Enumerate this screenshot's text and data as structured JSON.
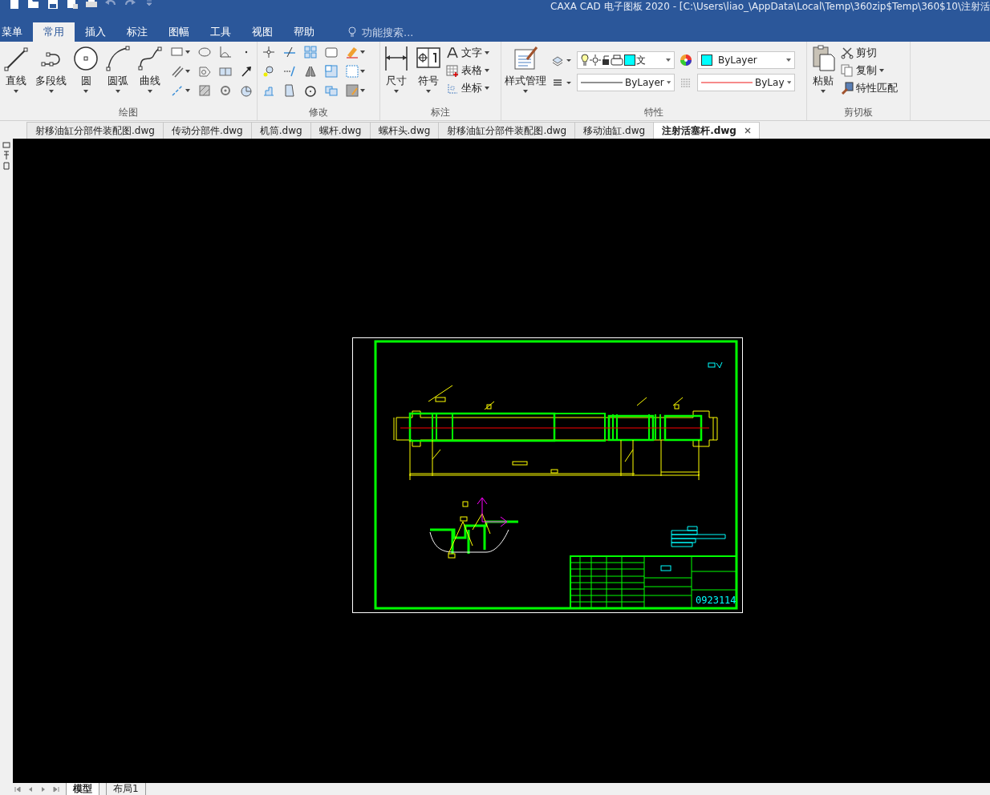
{
  "title_bar": {
    "title": "CAXA CAD 电子图板 2020 - [C:\\Users\\liao_\\AppData\\Local\\Temp\\360zip$Temp\\360$10\\注射活"
  },
  "menu_tabs": [
    {
      "label": "菜单",
      "selected": false
    },
    {
      "label": "常用",
      "selected": true
    },
    {
      "label": "插入",
      "selected": false
    },
    {
      "label": "标注",
      "selected": false
    },
    {
      "label": "图幅",
      "selected": false
    },
    {
      "label": "工具",
      "selected": false
    },
    {
      "label": "视图",
      "selected": false
    },
    {
      "label": "帮助",
      "selected": false
    }
  ],
  "search": {
    "placeholder": "功能搜索..."
  },
  "ribbon_groups": [
    {
      "kind": "draw",
      "title": "绘图",
      "large_buttons": [
        {
          "label": "直线"
        },
        {
          "label": "多段线"
        },
        {
          "label": "圆"
        },
        {
          "label": "圆弧"
        },
        {
          "label": "曲线"
        }
      ]
    },
    {
      "kind": "modify",
      "title": "修改"
    },
    {
      "kind": "annotate",
      "title": "标注",
      "large_buttons": [
        {
          "label": "尺寸"
        },
        {
          "label": "符号"
        }
      ],
      "small_buttons": [
        {
          "label": "文字"
        },
        {
          "label": "表格"
        },
        {
          "label": "坐标"
        }
      ]
    },
    {
      "kind": "properties",
      "title": "特性",
      "large_buttons": [
        {
          "label": "样式管理"
        }
      ],
      "layer": "文",
      "color_setting": "ByLayer",
      "linetype": "ByLayer",
      "lineweight": "ByLay"
    },
    {
      "kind": "clipboard",
      "title": "剪切板",
      "large_buttons": [
        {
          "label": "粘贴"
        }
      ],
      "small_buttons": [
        {
          "label": "剪切"
        },
        {
          "label": "复制"
        },
        {
          "label": "特性匹配"
        }
      ]
    }
  ],
  "doc_tabs": [
    {
      "label": "射移油缸分部件装配图.dwg",
      "selected": false
    },
    {
      "label": "传动分部件.dwg",
      "selected": false
    },
    {
      "label": "机筒.dwg",
      "selected": false
    },
    {
      "label": "螺杆.dwg",
      "selected": false
    },
    {
      "label": "螺杆头.dwg",
      "selected": false
    },
    {
      "label": "射移油缸分部件装配图.dwg",
      "selected": false
    },
    {
      "label": "移动油缸.dwg",
      "selected": false
    },
    {
      "label": "注射活塞杆.dwg",
      "selected": true
    }
  ],
  "drawing": {
    "drawing_number": "0923114"
  },
  "layout_tabs": [
    {
      "label": "模型",
      "selected": true
    },
    {
      "label": "布局1",
      "selected": false
    }
  ]
}
